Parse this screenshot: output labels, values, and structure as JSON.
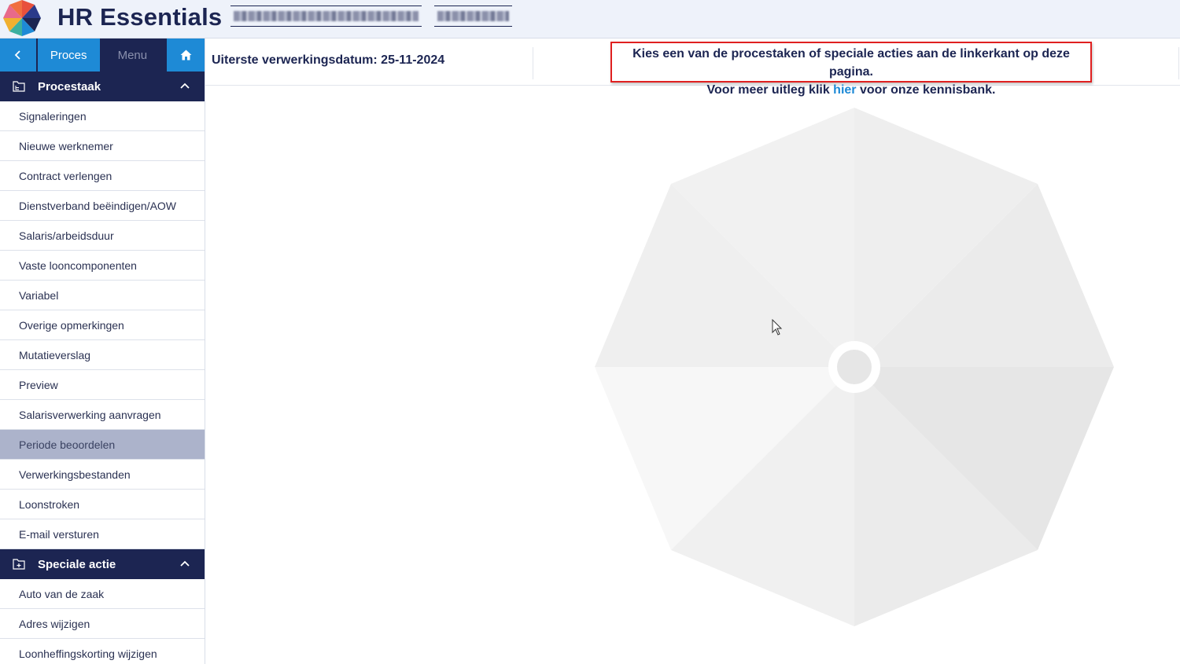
{
  "app": {
    "title": "HR Essentials",
    "accent_color": "#1e8ad6",
    "navy_color": "#1c2552",
    "logo_icon": "color-wheel-logo"
  },
  "nav": {
    "back_icon": "chevron-left-icon",
    "proces_label": "Proces",
    "menu_label": "Menu",
    "home_icon": "home-icon"
  },
  "sections": [
    {
      "title": "Procestaak",
      "icon": "folder-tree-icon",
      "toggle_icon": "chevron-up-icon",
      "items": [
        "Signaleringen",
        "Nieuwe werknemer",
        "Contract verlengen",
        "Dienstverband beëindigen/AOW",
        "Salaris/arbeidsduur",
        "Vaste looncomponenten",
        "Variabel",
        "Overige opmerkingen",
        "Mutatieverslag",
        "Preview",
        "Salarisverwerking aanvragen",
        "Periode beoordelen",
        "Verwerkingsbestanden",
        "Loonstroken",
        "E-mail versturen"
      ],
      "active_item": "Periode beoordelen"
    },
    {
      "title": "Speciale actie",
      "icon": "folder-add-icon",
      "toggle_icon": "chevron-up-icon",
      "items": [
        "Auto van de zaak",
        "Adres wijzigen",
        "Loonheffingskorting wijzigen"
      ]
    }
  ],
  "header": {
    "deadline_text": "Uiterste verwerkingsdatum: 25-11-2024",
    "notice_line1": "Kies een van de procestaken of speciale acties aan de linkerkant op deze pagina.",
    "notice_line2_before": "Voor meer uitleg klik ",
    "notice_link": "hier",
    "notice_line2_after": " voor onze kennisbank."
  }
}
